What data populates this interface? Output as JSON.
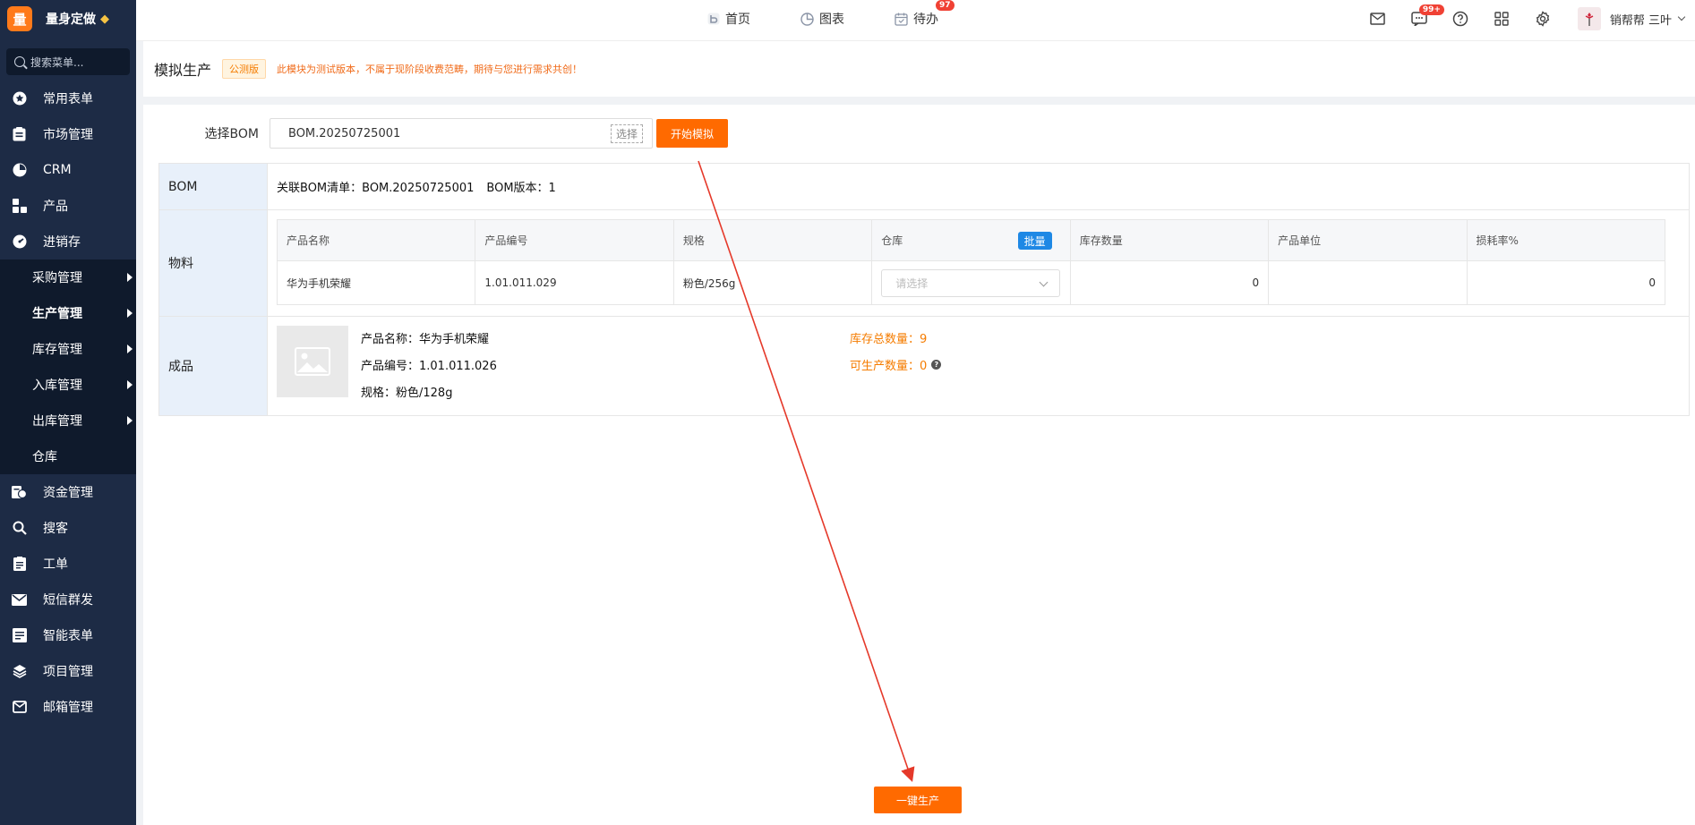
{
  "brand": {
    "logo_char": "量",
    "name": "量身定做"
  },
  "sidebar": {
    "search_placeholder": "搜索菜单...",
    "top_items": [
      {
        "label": "常用表单",
        "icon": "star-icon"
      },
      {
        "label": "市场管理",
        "icon": "clipboard-icon"
      },
      {
        "label": "CRM",
        "icon": "pie-chart-icon"
      },
      {
        "label": "产品",
        "icon": "grid-icon"
      },
      {
        "label": "进销存",
        "icon": "gauge-icon"
      }
    ],
    "sub_items": [
      {
        "label": "采购管理"
      },
      {
        "label": "生产管理"
      },
      {
        "label": "库存管理"
      },
      {
        "label": "入库管理"
      },
      {
        "label": "出库管理"
      },
      {
        "label": "仓库"
      }
    ],
    "bottom_items": [
      {
        "label": "资金管理",
        "icon": "money-icon"
      },
      {
        "label": "搜客",
        "icon": "search-icon"
      },
      {
        "label": "工单",
        "icon": "document-icon"
      },
      {
        "label": "短信群发",
        "icon": "envelope-icon"
      },
      {
        "label": "智能表单",
        "icon": "form-icon"
      },
      {
        "label": "项目管理",
        "icon": "layers-icon"
      },
      {
        "label": "邮箱管理",
        "icon": "mail-icon"
      }
    ]
  },
  "topbar": {
    "nav": [
      {
        "label": "首页",
        "icon": "home-icon"
      },
      {
        "label": "图表",
        "icon": "chart-icon"
      },
      {
        "label": "待办",
        "icon": "calendar-icon",
        "badge": "97"
      }
    ],
    "message_badge": "99+",
    "username": "销帮帮 三叶"
  },
  "page": {
    "title": "模拟生产",
    "tag": "公测版",
    "notice": "此模块为测试版本，不属于现阶段收费范畴，期待与您进行需求共创！"
  },
  "bom_select": {
    "label": "选择BOM",
    "value": "BOM.20250725001",
    "pick_label": "选择",
    "start_label": "开始模拟"
  },
  "bom_section": {
    "head": "BOM",
    "list_text": "关联BOM清单：BOM.20250725001",
    "version_text": "BOM版本：1"
  },
  "material_section": {
    "head": "物料",
    "columns": [
      "产品名称",
      "产品编号",
      "规格",
      "仓库",
      "库存数量",
      "产品单位",
      "损耗率%"
    ],
    "batch_label": "批量",
    "rows": [
      {
        "name": "华为手机荣耀",
        "code": "1.01.011.029",
        "spec": "粉色/256g",
        "warehouse_placeholder": "请选择",
        "stock": "0",
        "unit": "",
        "loss": "0"
      }
    ]
  },
  "product_section": {
    "head": "成品",
    "name_text": "产品名称：华为手机荣耀",
    "code_text": "产品编号：1.01.011.026",
    "spec_text": "规格：粉色/128g",
    "stock_total_text": "库存总数量：9",
    "producible_text": "可生产数量：0"
  },
  "actions": {
    "one_click_label": "一键生产"
  },
  "colors": {
    "accent": "#ff6a00",
    "sidebar_bg": "#1d2b45",
    "annotation_arrow": "#e5392a",
    "batch_blue": "#1e88e5"
  }
}
